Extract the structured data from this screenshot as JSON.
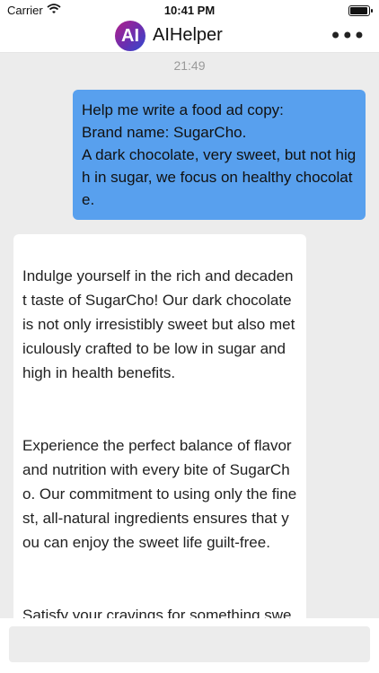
{
  "status_bar": {
    "carrier": "Carrier",
    "time": "10:41 PM",
    "wifi_icon": "wifi-icon",
    "battery_icon": "battery-icon",
    "battery_level": 1.0
  },
  "header": {
    "avatar_text": "AI",
    "title": "AIHelper",
    "more_icon": "more-horizontal-icon"
  },
  "chat": {
    "timestamp": "21:49",
    "user_message": "Help me write a food ad copy:\nBrand name: SugarCho.\nA dark chocolate, very sweet, but not high in sugar, we focus on healthy chocolate.",
    "ai_paragraphs": [
      "Indulge yourself in the rich and decadent taste of SugarCho! Our dark chocolate is not only irresistibly sweet but also meticulously crafted to be low in sugar and high in health benefits.",
      "Experience the perfect balance of flavor and nutrition with every bite of SugarCho. Our commitment to using only the finest, all-natural ingredients ensures that you can enjoy the sweet life guilt-free.",
      "Satisfy your cravings for something sweet without compromising on your healthy lifestyle with SugarCho. A tre"
    ]
  },
  "composer": {
    "placeholder": "",
    "value": ""
  },
  "colors": {
    "user_bubble": "#58a0ee",
    "background": "#ececec"
  }
}
